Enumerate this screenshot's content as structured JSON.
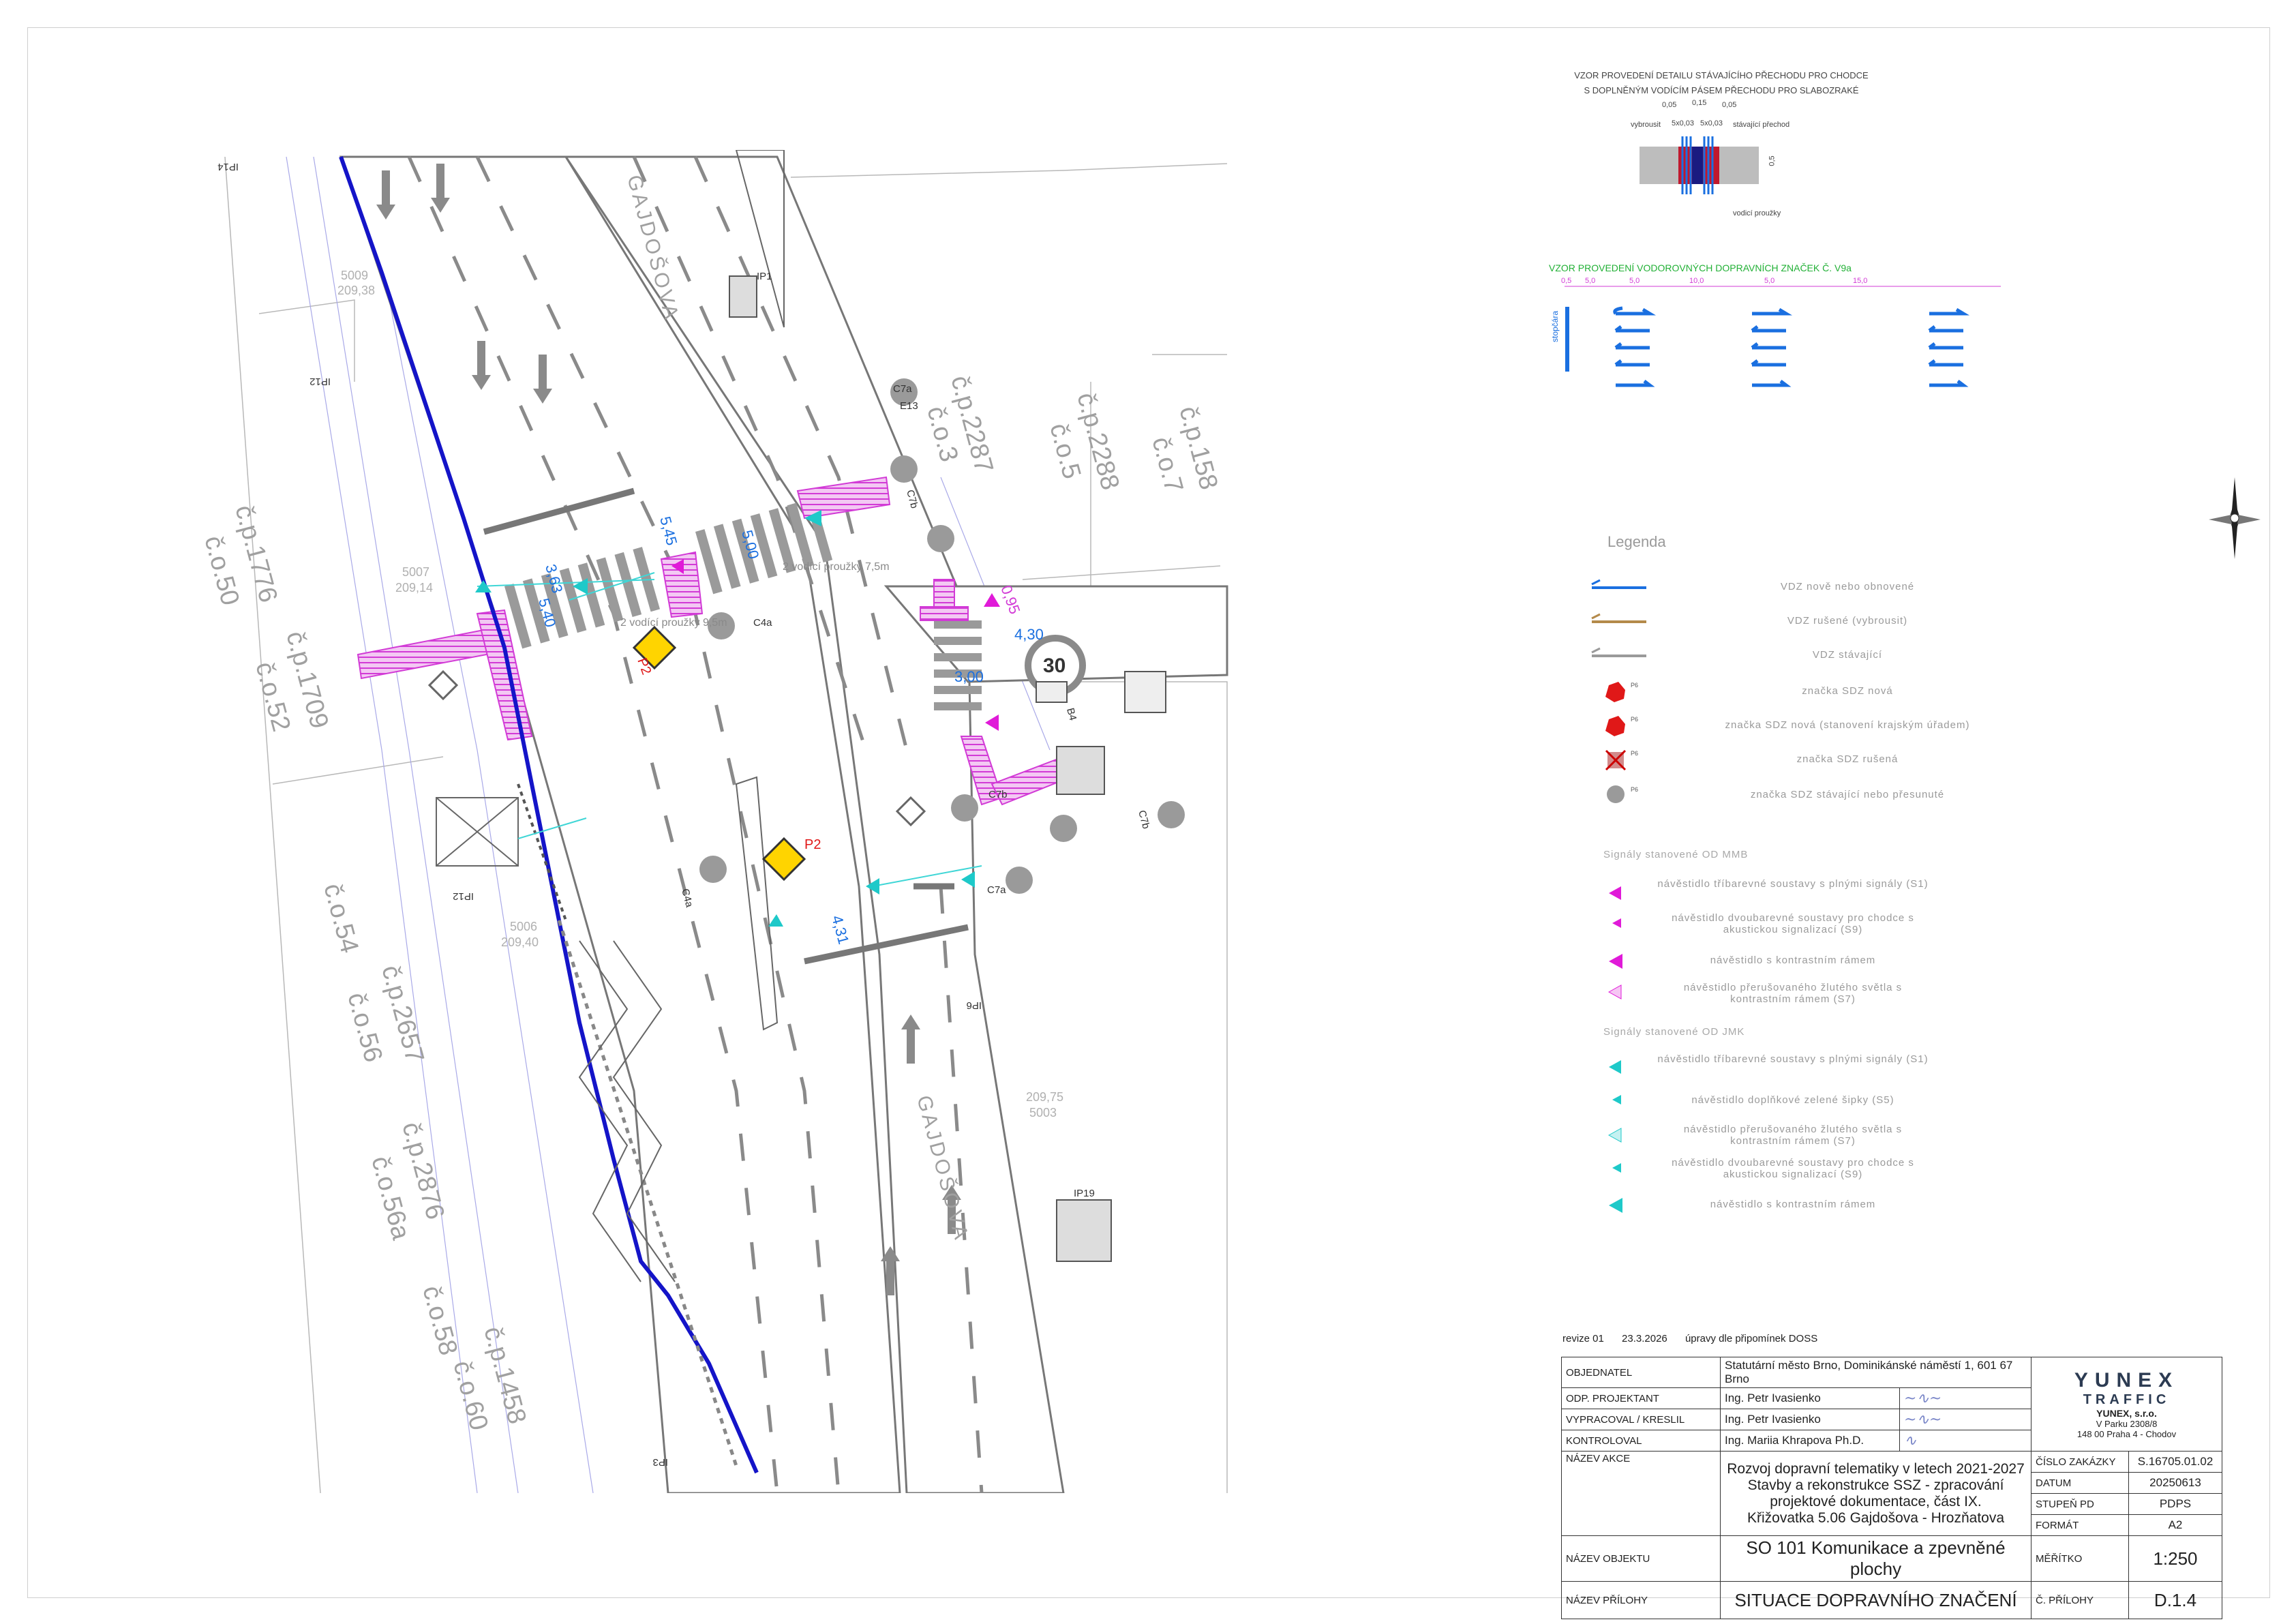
{
  "colors": {
    "vdz_new": "#1a6fe0",
    "vdz_removed": "#b48a4a",
    "vdz_existing": "#9a9a9a",
    "tactile": "#d23bd6",
    "signal_mmb": "#e01ad8",
    "signal_jmk": "#1ec9c9",
    "route_blue": "#1414c8",
    "sign_red": "#e01818"
  },
  "streets": {
    "gajdosova_north": "GAJDOŠOVA",
    "gajdosova_south": "GAJDOŠOVA"
  },
  "houses": [
    "č.p.1776",
    "č.o.50",
    "č.p.1709",
    "č.o.52",
    "č.o.54",
    "č.p.2657",
    "č.o.56",
    "č.p.2876",
    "č.o.56a",
    "č.o.58",
    "č.p.1458",
    "č.o.60",
    "č.p.2287",
    "č.o.3",
    "č.p.2288",
    "č.o.5",
    "č.p.158",
    "č.o.7"
  ],
  "dimensions": {
    "d363": "3,63",
    "d540": "5,40",
    "d545": "5,45",
    "d500": "5,00",
    "d430": "4,30",
    "d300": "3,00",
    "d431": "4,31",
    "d095": "0,95",
    "pas1": "2 vodící proužky 7,5m",
    "pas2": "2 vodící proužky 9,5m"
  },
  "signs": {
    "p2a": "P2",
    "p2b": "P2",
    "c4a": "C4a",
    "c4a2": "C4a",
    "c7a": "C7a",
    "c7b": "C7b",
    "c7b2": "C7b",
    "c7b3": "C7b",
    "c7a2": "C7a",
    "e13": "E13",
    "ip1": "IP1",
    "ip12": "IP12",
    "ip12b": "IP12",
    "ip14": "IP14",
    "ip19": "IP19",
    "b4": "B4",
    "d4": "B4",
    "speed": "30",
    "ip3": "IP3",
    "ip6": "IP6"
  },
  "levels": {
    "l1": "5007",
    "l1v": "209,14",
    "l2": "5006",
    "l2v": "209,40",
    "l3": "209,75",
    "l3v": "5003",
    "l4": "5009",
    "l4v": "209,38"
  },
  "detail": {
    "title1": "VZOR PROVEDENÍ DETAILU STÁVAJÍCÍHO PŘECHODU PRO CHODCE",
    "title2": "S DOPLNĚNÝM VODÍCÍM PÁSEM PŘECHODU PRO SLABOZRAKÉ",
    "vybrousit": "vybrousit",
    "stavajici": "stávající přechod",
    "vodici": "vodicí proužky",
    "d005": "0,05",
    "d015": "0,15",
    "d005b": "0,05",
    "d5x003": "5x0,03",
    "d5x003b": "5x0,03",
    "d05": "0,5"
  },
  "v9a": {
    "title": "VZOR PROVEDENÍ VODOROVNÝCH DOPRAVNÍCH ZNAČEK Č. V9a",
    "stopcara": "stopčára",
    "dims": [
      "0,5",
      "5,0",
      "5,0",
      "10,0",
      "5,0",
      "15,0"
    ]
  },
  "legend": {
    "title": "Legenda",
    "rows": [
      "VDZ nově nebo obnovené",
      "VDZ rušené (vybrousit)",
      "VDZ stávající",
      "značka SDZ nová",
      "značka SDZ nová (stanovení krajským úřadem)",
      "značka SDZ rušená",
      "značka SDZ stávající nebo přesunuté"
    ],
    "sign_tag": "P6",
    "mmb_title": "Signály stanovené OD MMB",
    "mmb": [
      "návěstidlo tříbarevné soustavy s plnými signály (S1)",
      "návěstidlo dvoubarevné soustavy pro chodce s akustickou signalizací (S9)",
      "návěstidlo s kontrastním rámem",
      "návěstidlo přerušovaného žlutého světla s kontrastním rámem (S7)"
    ],
    "jmk_title": "Signály stanovené OD JMK",
    "jmk": [
      "návěstidlo tříbarevné soustavy s plnými signály (S1)",
      "návěstidlo doplňkové zelené šipky (S5)",
      "návěstidlo přerušovaného žlutého světla s kontrastním rámem (S7)",
      "návěstidlo dvoubarevné soustavy pro chodce s akustickou signalizací (S9)",
      "návěstidlo s kontrastním rámem"
    ]
  },
  "revision": {
    "rev": "revize 01",
    "date": "23.3.2026",
    "text": "úpravy dle připomínek DOSS"
  },
  "titleblock": {
    "objednatel_lbl": "OBJEDNATEL",
    "objednatel": "Statutární město Brno, Dominikánské náměstí 1,  601 67 Brno",
    "odp_lbl": "ODP. PROJEKTANT",
    "odp": "Ing. Petr Ivasienko",
    "vyprac_lbl": "VYPRACOVAL / KRESLIL",
    "vyprac": "Ing. Petr Ivasienko",
    "kontrol_lbl": "KONTROLOVAL",
    "kontrol": "Ing. Mariia Khrapova Ph.D.",
    "logo1": "YUNEX",
    "logo2": "TRAFFIC",
    "company": "YUNEX, s.r.o.",
    "addr1": "V Parku 2308/8",
    "addr2": "148 00 Praha 4 - Chodov",
    "akce_lbl": "NÁZEV AKCE",
    "akce": [
      "Rozvoj dopravní telematiky v letech 2021-2027",
      "Stavby a rekonstrukce SSZ - zpracování",
      "projektové dokumentace, část IX.",
      "Křižovatka 5.06 Gajdošova - Hrozňatova"
    ],
    "zakazka_lbl": "ČÍSLO ZAKÁZKY",
    "zakazka": "S.16705.01.02",
    "datum_lbl": "DATUM",
    "datum": "20250613",
    "stupen_lbl": "STUPEŇ PD",
    "stupen": "PDPS",
    "format_lbl": "FORMÁT",
    "format": "A2",
    "objekt_lbl": "NÁZEV OBJEKTU",
    "objekt": "SO 101 Komunikace a zpevněné plochy",
    "meritko_lbl": "MĚŘÍTKO",
    "meritko": "1:250",
    "priloha_lbl": "NÁZEV PŘÍLOHY",
    "priloha": "SITUACE DOPRAVNÍHO ZNAČENÍ",
    "cislo_lbl": "Č. PŘÍLOHY",
    "cislo": "D.1.4"
  }
}
